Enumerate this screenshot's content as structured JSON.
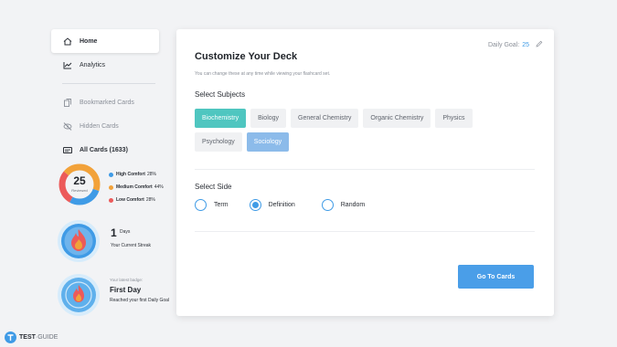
{
  "sidebar": {
    "items": [
      {
        "label": "Home",
        "icon": "home-icon"
      },
      {
        "label": "Analytics",
        "icon": "analytics-icon"
      },
      {
        "label": "Bookmarked Cards",
        "icon": "bookmark-icon"
      },
      {
        "label": "Hidden Cards",
        "icon": "eye-off-icon"
      },
      {
        "label": "All Cards (1633)",
        "icon": "cards-icon"
      }
    ]
  },
  "comfort": {
    "reviewed_count": "25",
    "reviewed_label": "Reviewed",
    "legend": [
      {
        "name": "High Comfort",
        "value": "28%",
        "percent": 28,
        "color": "#3f9be6"
      },
      {
        "name": "Medium Comfort",
        "value": "44%",
        "percent": 44,
        "color": "#f2a23a"
      },
      {
        "name": "Low Comfort",
        "value": "28%",
        "percent": 28,
        "color": "#ec5a5a"
      }
    ]
  },
  "streak": {
    "count": "1",
    "unit": "Days",
    "label": "Your Current Streak"
  },
  "badge": {
    "caption": "Your latest badge:",
    "title": "First Day",
    "description": "Reached your first Daily Goal"
  },
  "deck": {
    "daily_goal_label": "Daily Goal:",
    "daily_goal_value": "25",
    "title": "Customize Your Deck",
    "subtitle": "You can change these at any time while viewing your flashcard set.",
    "subjects_label": "Select Subjects",
    "subjects": [
      {
        "label": "Biochemistry",
        "state": "selected-teal"
      },
      {
        "label": "Biology",
        "state": "unselected"
      },
      {
        "label": "General Chemistry",
        "state": "unselected"
      },
      {
        "label": "Organic Chemistry",
        "state": "unselected"
      },
      {
        "label": "Physics",
        "state": "unselected"
      },
      {
        "label": "Psychology",
        "state": "unselected"
      },
      {
        "label": "Sociology",
        "state": "selected-blue"
      }
    ],
    "side_label": "Select Side",
    "sides": [
      {
        "label": "Term",
        "selected": false
      },
      {
        "label": "Definition",
        "selected": true
      },
      {
        "label": "Random",
        "selected": false
      }
    ],
    "go_button": "Go To Cards"
  },
  "logo": {
    "brand": "TEST",
    "suffix": "GUIDE"
  },
  "colors": {
    "accent": "#3f9be6",
    "teal": "#4fc6c0",
    "high": "#3f9be6",
    "medium": "#f2a23a",
    "low": "#ec5a5a"
  }
}
